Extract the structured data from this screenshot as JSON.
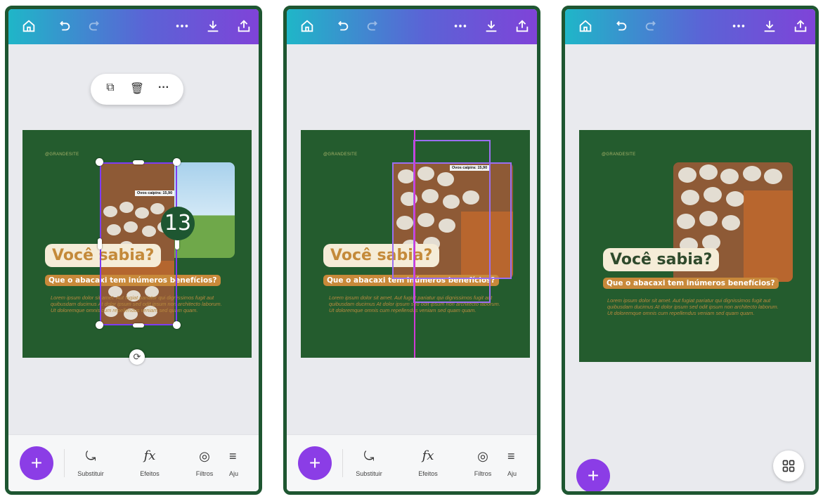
{
  "toolbar": {
    "icons": [
      "home-icon",
      "undo-icon",
      "redo-icon",
      "more-icon",
      "download-icon",
      "share-icon"
    ],
    "gradient": [
      "#1fb6c8",
      "#7f43d8"
    ]
  },
  "design": {
    "watermark": "@GRANDESITE",
    "title": "Você sabia?",
    "subtitle": "Que o abacaxi tem inúmeros benefícios?",
    "body": "Lorem ipsum dolor sit amet. Aut fugiat pariatur qui dignissimos fugit aut quibusdam ducimus At dolor ipsum sed odit ipsum non architecto laborum. Ut doloremque omnis cum repellendus veniam sed quam quam.",
    "price_tag": "Ovos caipira: 15,90",
    "background": "#245c2e"
  },
  "bottombar": {
    "add_label": "+",
    "tools": [
      {
        "icon": "replace-icon",
        "label": "Substituir"
      },
      {
        "icon": "effects-icon",
        "label": "Efeitos"
      },
      {
        "icon": "filters-icon",
        "label": "Filtros"
      },
      {
        "icon": "adjust-icon",
        "label": "Aju"
      }
    ]
  },
  "context_menu": {
    "items": [
      "duplicate-icon",
      "trash-icon",
      "more-icon"
    ]
  },
  "step_badge": "13",
  "colors": {
    "frame": "#1e5631",
    "accent": "#8b3de6",
    "selection": "#7d3cf2"
  }
}
